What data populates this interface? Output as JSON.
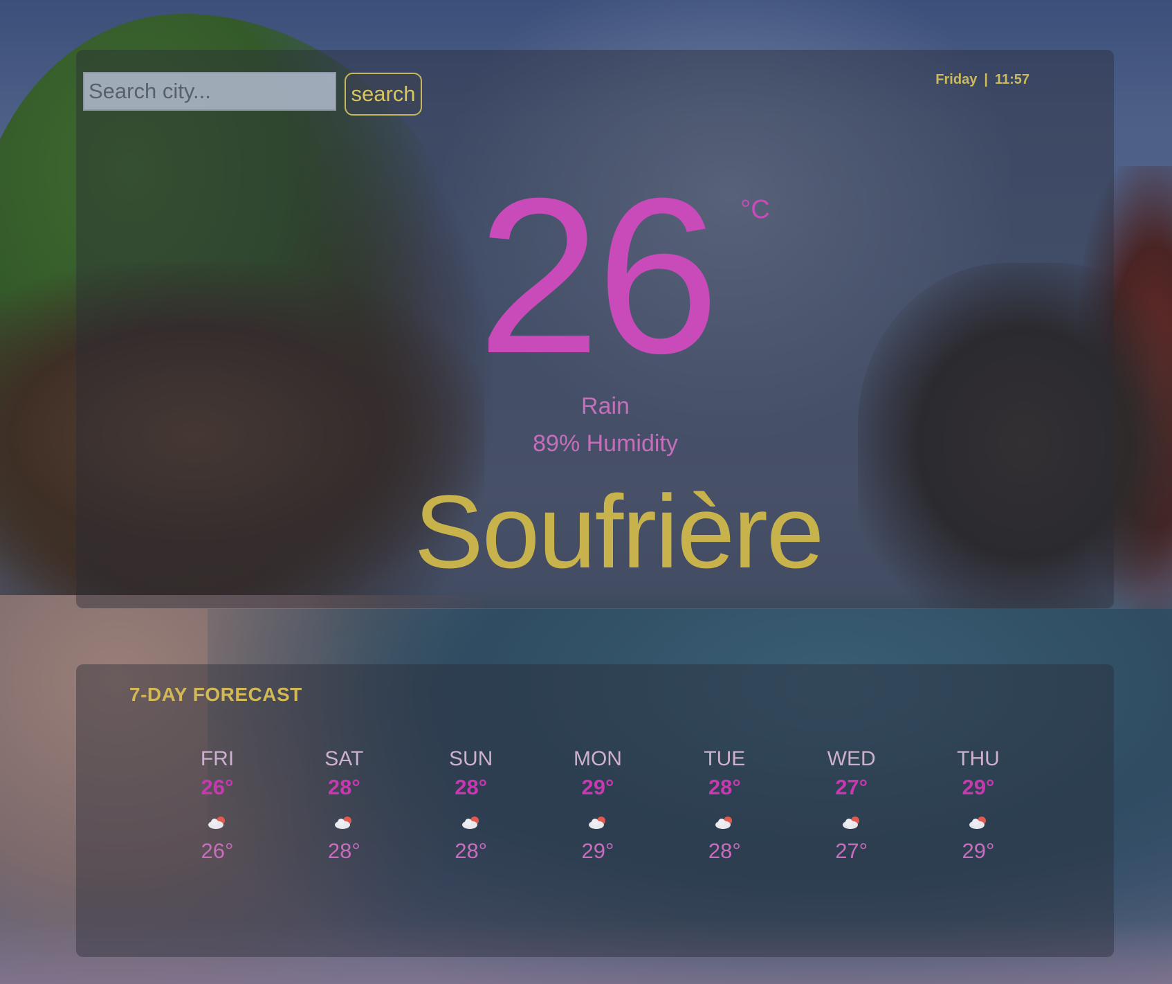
{
  "search": {
    "placeholder": "Search city...",
    "value": "",
    "button_label": "search"
  },
  "header": {
    "day": "Friday",
    "separator": "|",
    "time": "11:57"
  },
  "current": {
    "temperature": "26",
    "unit": "°C",
    "condition": "Rain",
    "humidity": "89% Humidity",
    "city": "Soufrière"
  },
  "forecast": {
    "title": "7-DAY FORECAST",
    "days": [
      {
        "day": "FRI",
        "high": "26°",
        "icon": "rain-cloud-icon",
        "low": "26°"
      },
      {
        "day": "SAT",
        "high": "28°",
        "icon": "rain-cloud-icon",
        "low": "28°"
      },
      {
        "day": "SUN",
        "high": "28°",
        "icon": "rain-cloud-icon",
        "low": "28°"
      },
      {
        "day": "MON",
        "high": "29°",
        "icon": "rain-cloud-icon",
        "low": "29°"
      },
      {
        "day": "TUE",
        "high": "28°",
        "icon": "rain-cloud-icon",
        "low": "28°"
      },
      {
        "day": "WED",
        "high": "27°",
        "icon": "rain-cloud-icon",
        "low": "27°"
      },
      {
        "day": "THU",
        "high": "29°",
        "icon": "rain-cloud-icon",
        "low": "29°"
      }
    ]
  },
  "colors": {
    "temperature": "#c94bba",
    "city": "#c7b24c",
    "accent_gold": "#d3b956",
    "forecast_high": "#c838b0"
  }
}
